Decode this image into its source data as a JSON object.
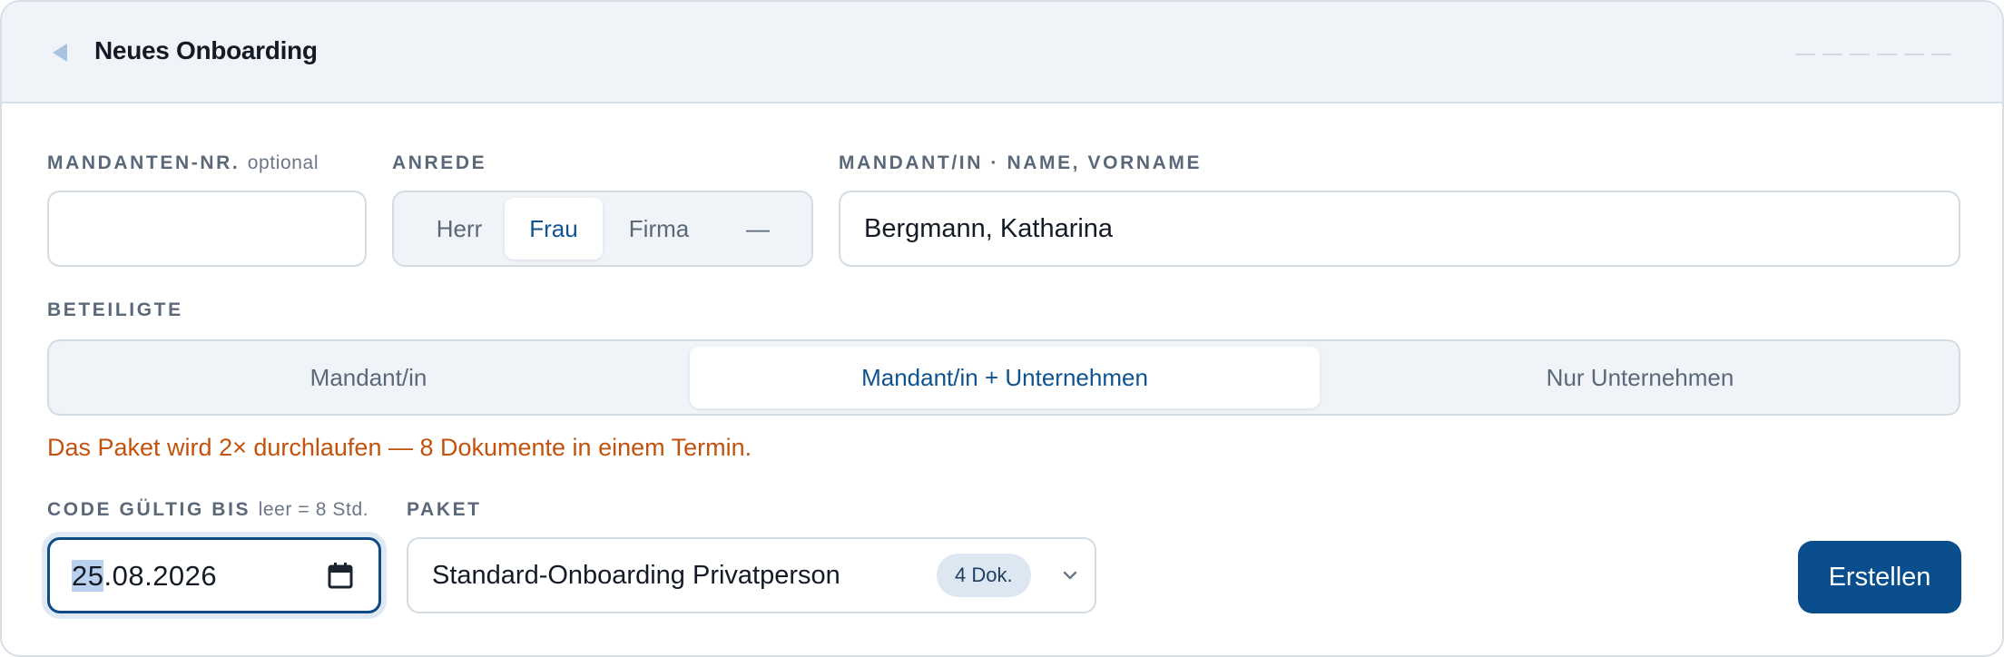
{
  "header": {
    "title": "Neues Onboarding"
  },
  "client_number": {
    "label": "MANDANTEN-NR.",
    "hint": "optional",
    "value": ""
  },
  "salutation": {
    "label": "ANREDE",
    "options": [
      "Herr",
      "Frau",
      "Firma",
      "—"
    ],
    "selected": "Frau"
  },
  "client_name": {
    "label": "MANDANT/IN · NAME, VORNAME",
    "value": "Bergmann, Katharina"
  },
  "participants": {
    "label": "BETEILIGTE",
    "options": [
      "Mandant/in",
      "Mandant/in + Unternehmen",
      "Nur Unternehmen"
    ],
    "selected": "Mandant/in + Unternehmen"
  },
  "notice": "Das Paket wird 2× durchlaufen — 8 Dokumente in einem Termin.",
  "code_valid": {
    "label": "CODE GÜLTIG BIS",
    "hint": "leer = 8 Std.",
    "day": "25",
    "rest": ".08.2026"
  },
  "package": {
    "label": "PAKET",
    "value": "Standard-Onboarding Privatperson",
    "badge": "4 Dok."
  },
  "submit": {
    "label": "Erstellen"
  },
  "colors": {
    "accent": "#0a4d8c",
    "notice": "#c2520c",
    "header_bg": "#f0f4f8"
  }
}
